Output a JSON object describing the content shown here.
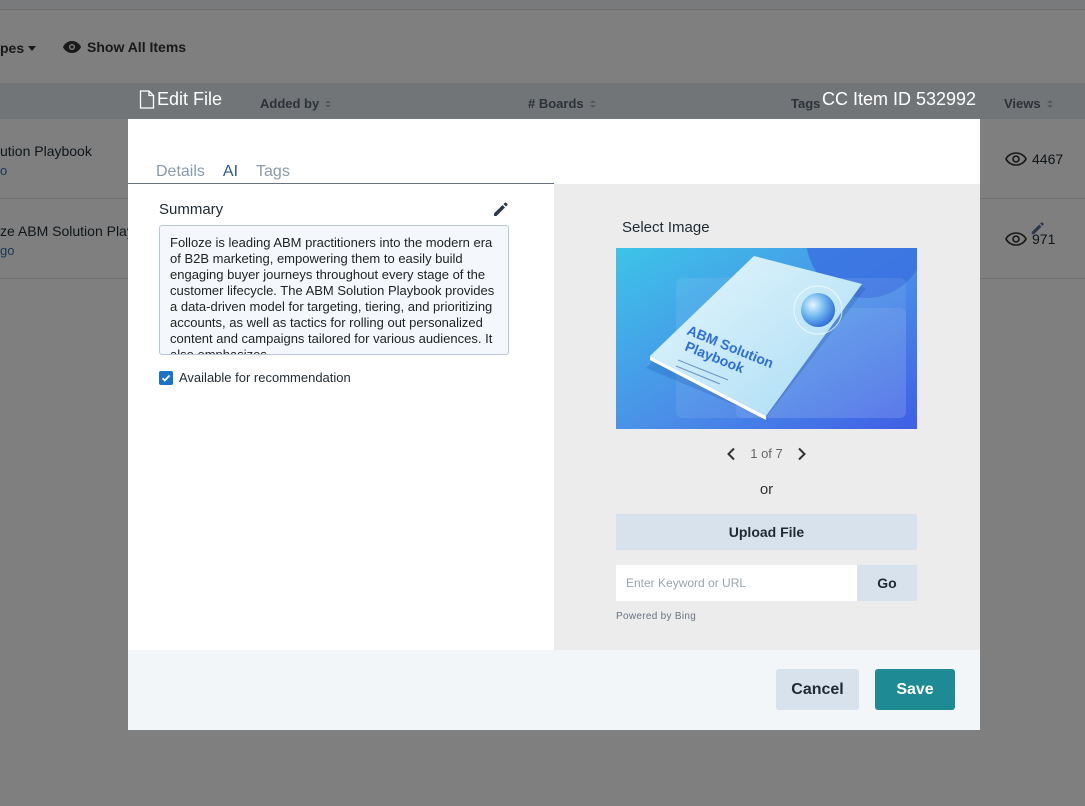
{
  "background": {
    "types_label": "pes",
    "show_all_label": "Show All Items",
    "columns": {
      "added_by": "Added by",
      "boards": "# Boards",
      "tags": "Tags",
      "views": "Views"
    },
    "rows": [
      {
        "title": "ution Playbook",
        "sub": "o",
        "views": "4467"
      },
      {
        "title": "ze ABM Solution Play",
        "sub": "go",
        "views": "971"
      }
    ]
  },
  "modal": {
    "title": "Edit File",
    "item_id": "CC Item ID 532992",
    "tabs": [
      {
        "label": "Details",
        "active": false
      },
      {
        "label": "AI",
        "active": true
      },
      {
        "label": "Tags",
        "active": false
      }
    ],
    "summary": {
      "label": "Summary",
      "text": "Folloze is leading ABM practitioners into the modern era of B2B marketing, empowering them to easily build engaging buyer journeys throughout every stage of the customer lifecycle. The ABM Solution Playbook provides a data-driven model for targeting, tiering, and prioritizing accounts, as well as tactics for rolling out personalized content and campaigns tailored for various audiences. It also emphasizes"
    },
    "recommendation": {
      "label": "Available for recommendation",
      "checked": true
    },
    "image": {
      "label": "Select Image",
      "book_title": "ABM Solution Playbook",
      "pager": "1 of 7",
      "or": "or",
      "upload_label": "Upload File",
      "search_placeholder": "Enter Keyword or URL",
      "go_label": "Go",
      "powered_by": "Powered by Bing"
    },
    "footer": {
      "cancel_label": "Cancel",
      "save_label": "Save"
    },
    "colors": {
      "save": "#1e8a94",
      "checkbox": "#1a73c8",
      "tab_active": "#2a6bb0"
    }
  }
}
